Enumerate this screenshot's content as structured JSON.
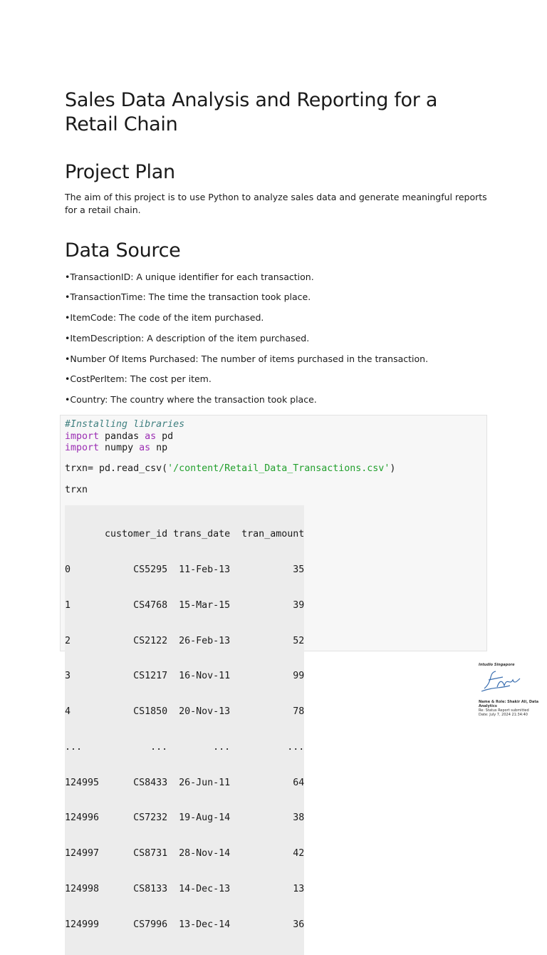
{
  "title": "Sales Data Analysis and Reporting for a Retail Chain",
  "project_plan": {
    "heading": "Project Plan",
    "text": "The aim of this project is to use Python to analyze sales data and generate meaningful reports for a retail chain."
  },
  "data_source": {
    "heading": "Data Source",
    "items": [
      "•TransactionID: A unique identifier for each transaction.",
      "•TransactionTime: The time the transaction took place.",
      "•ItemCode: The code of the item purchased.",
      "•ItemDescription: A description of the item purchased.",
      "•Number Of Items Purchased: The number of items purchased in the transaction.",
      "•CostPerItem: The cost per item.",
      "•Country: The country where the transaction took place."
    ]
  },
  "code": {
    "comment": "#Installing libraries",
    "kw_import": "import",
    "kw_as": "as",
    "lib1": " pandas ",
    "alias1": " pd",
    "lib2": " numpy ",
    "alias2": " np",
    "read_prefix": "trxn= pd.read_csv(",
    "read_path": "'/content/Retail_Data_Transactions.csv'",
    "read_suffix": ")",
    "show": "trxn"
  },
  "output_table": {
    "header": "       customer_id trans_date  tran_amount",
    "rows": [
      "0           CS5295  11-Feb-13           35",
      "1           CS4768  15-Mar-15           39",
      "2           CS2122  26-Feb-13           52",
      "3           CS1217  16-Nov-11           99",
      "4           CS1850  20-Nov-13           78",
      "...            ...        ...          ...",
      "124995      CS8433  26-Jun-11           64",
      "124996      CS7232  19-Aug-14           38",
      "124997      CS8731  28-Nov-14           42",
      "124998      CS8133  14-Dec-13           13",
      "124999      CS7996  13-Dec-14           36"
    ]
  },
  "signature": {
    "org": "Intudio Singapore",
    "name_role": "Name & Role: Shakir Ali, Data Analytics",
    "re": "Re: Status Report submitted",
    "date": "Date: July 7, 2024 21:34:40"
  }
}
